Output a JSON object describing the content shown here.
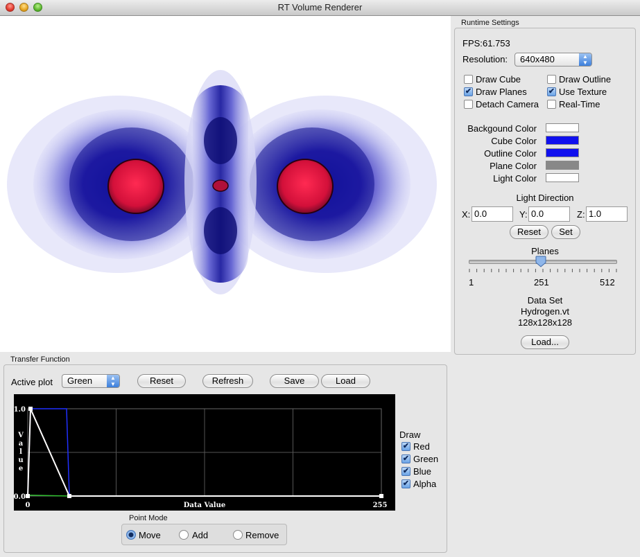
{
  "window": {
    "title": "RT Volume Renderer"
  },
  "runtime": {
    "group_title": "Runtime Settings",
    "fps_label": "FPS:",
    "fps_value": "61.753",
    "resolution_label": "Resolution:",
    "resolution_value": "640x480",
    "checkboxes": [
      {
        "label": "Draw Cube",
        "checked": false
      },
      {
        "label": "Draw Outline",
        "checked": false
      },
      {
        "label": "Draw Planes",
        "checked": true
      },
      {
        "label": "Use Texture",
        "checked": true
      },
      {
        "label": "Detach Camera",
        "checked": false
      },
      {
        "label": "Real-Time",
        "checked": false
      }
    ],
    "colors": [
      {
        "label": "Backgound Color",
        "value": "#ffffff"
      },
      {
        "label": "Cube Color",
        "value": "#1010ee"
      },
      {
        "label": "Outline Color",
        "value": "#1010ee"
      },
      {
        "label": "Plane Color",
        "value": "#888888"
      },
      {
        "label": "Light Color",
        "value": "#ffffff"
      }
    ],
    "light": {
      "title": "Light Direction",
      "x_label": "X:",
      "x_value": "0.0",
      "y_label": "Y:",
      "y_value": "0.0",
      "z_label": "Z:",
      "z_value": "1.0",
      "reset_label": "Reset",
      "set_label": "Set"
    },
    "planes": {
      "title": "Planes",
      "min_label": "1",
      "mid_label": "251",
      "max_label": "512",
      "value": 251,
      "min": 1,
      "max": 512
    },
    "dataset": {
      "title": "Data Set",
      "name": "Hydrogen.vt",
      "dims": "128x128x128",
      "load_label": "Load..."
    }
  },
  "transfer": {
    "group_title": "Transfer Function",
    "active_plot_label": "Active plot",
    "active_plot_value": "Green",
    "reset_label": "Reset",
    "refresh_label": "Refresh",
    "save_label": "Save",
    "load_label": "Load",
    "draw": {
      "title": "Draw",
      "channels": [
        {
          "label": "Red",
          "checked": true
        },
        {
          "label": "Green",
          "checked": true
        },
        {
          "label": "Blue",
          "checked": true
        },
        {
          "label": "Alpha",
          "checked": true
        }
      ]
    },
    "point_mode": {
      "title": "Point Mode",
      "options": [
        {
          "label": "Move",
          "selected": true
        },
        {
          "label": "Add",
          "selected": false
        },
        {
          "label": "Remove",
          "selected": false
        }
      ]
    }
  },
  "chart_data": {
    "type": "line",
    "xlabel": "Data Value",
    "ylabel": "Value",
    "xlim": [
      0,
      255
    ],
    "ylim": [
      0.0,
      1.0
    ],
    "x_tick_labels": [
      "0",
      "255"
    ],
    "y_tick_labels": [
      "0.0",
      "1.0"
    ],
    "grid": true,
    "series": [
      {
        "name": "Red",
        "color": "#ff2020",
        "x": [
          0,
          2,
          30,
          255
        ],
        "y": [
          0.0,
          1.0,
          0.0,
          0.0
        ]
      },
      {
        "name": "Green",
        "color": "#30c030",
        "x": [
          0,
          30,
          255
        ],
        "y": [
          0.01,
          0.0,
          0.0
        ]
      },
      {
        "name": "Blue",
        "color": "#2030ff",
        "x": [
          0,
          2,
          28,
          30,
          255
        ],
        "y": [
          0.0,
          1.0,
          1.0,
          0.0,
          0.0
        ]
      },
      {
        "name": "Alpha",
        "color": "#ffffff",
        "x": [
          0,
          2,
          30,
          255
        ],
        "y": [
          0.0,
          1.0,
          0.0,
          0.0
        ]
      }
    ]
  }
}
